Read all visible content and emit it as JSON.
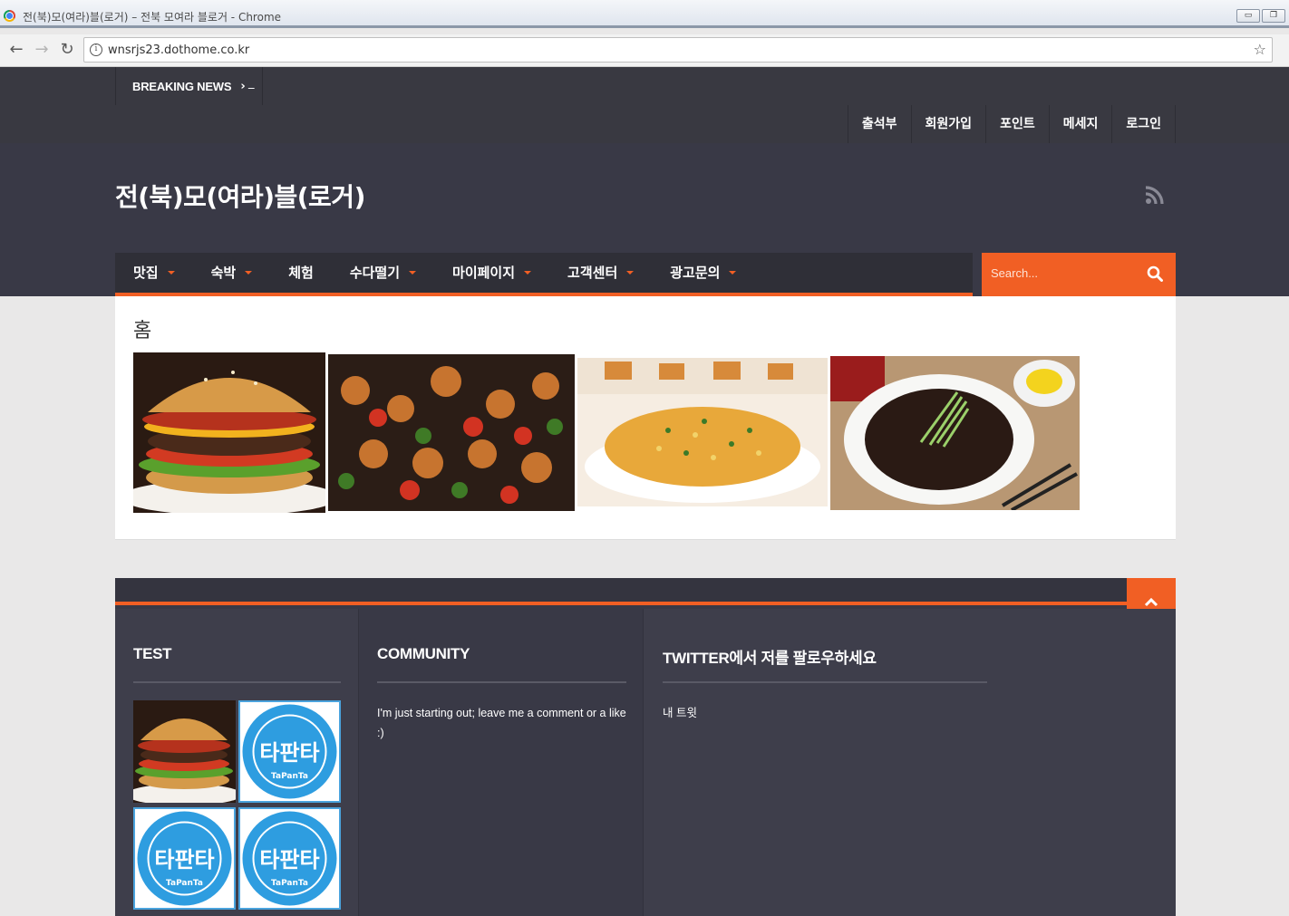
{
  "browser": {
    "window_title": "전(북)모(여라)블(로거) – 전북 모여라 블로거 - Chrome",
    "url": "wnsrjs23.dothome.co.kr"
  },
  "topbar": {
    "breaking_label": "BREAKING NEWS",
    "ticker": "_",
    "menu": [
      "출석부",
      "회원가입",
      "포인트",
      "메세지",
      "로그인"
    ]
  },
  "header": {
    "site_title": "전(북)모(여라)블(로거)"
  },
  "nav": {
    "items": [
      {
        "label": "맛집",
        "dropdown": true
      },
      {
        "label": "숙박",
        "dropdown": true
      },
      {
        "label": "체험",
        "dropdown": false
      },
      {
        "label": "수다떨기",
        "dropdown": true
      },
      {
        "label": "마이페이지",
        "dropdown": true
      },
      {
        "label": "고객센터",
        "dropdown": true
      },
      {
        "label": "광고문의",
        "dropdown": true
      }
    ],
    "search_placeholder": "Search..."
  },
  "content": {
    "page_title": "홈",
    "images": [
      "burger",
      "kebab-skewers",
      "fried-rice",
      "jajangmyeon"
    ]
  },
  "footer": {
    "col1_title": "TEST",
    "col2_title": "COMMUNITY",
    "col2_text": "I'm just starting out; leave me a comment or a like :)",
    "col3_title": "TWITTER에서 저를 팔로우하세요",
    "col3_text": "내 트윗",
    "badge_text": "타판타",
    "badge_sub": "TaPanTa"
  },
  "colors": {
    "accent": "#f15f24",
    "dark": "#393946"
  }
}
